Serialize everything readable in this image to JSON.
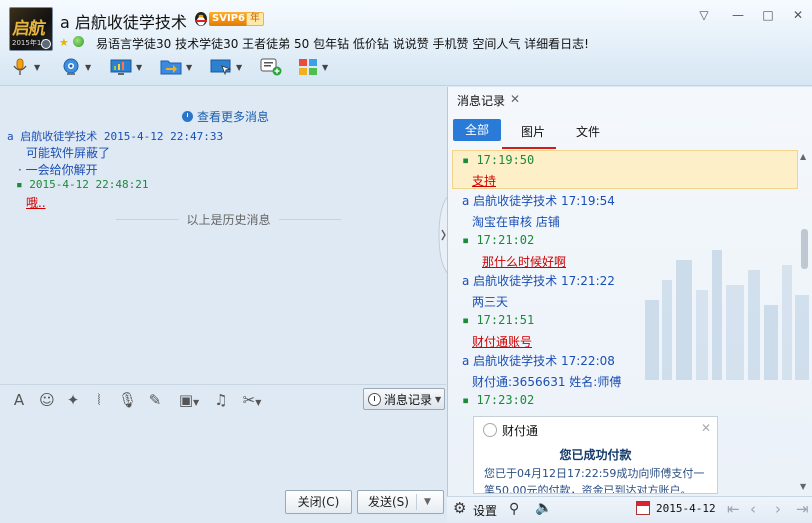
{
  "contact": {
    "name": "a 启航收徒学技术",
    "vip_level": "SVIP6",
    "vip_suffix": "年",
    "avatar_text": "启航",
    "avatar_year": "2015年1月",
    "signature": "易语言学徒30 技术学徒30 王者徒弟 50 包年钻 低价钻  说说赞 手机赞 空间人气 详细看日志!"
  },
  "window_controls": {
    "skin": "▽",
    "minimize": "—",
    "maximize": "□",
    "close": "✕"
  },
  "toolbar": {
    "items": [
      {
        "name": "microphone-icon"
      },
      {
        "name": "webcam-icon"
      },
      {
        "name": "screen-share-icon"
      },
      {
        "name": "file-transfer-icon"
      },
      {
        "name": "remote-desktop-icon"
      },
      {
        "name": "create-discussion-icon"
      },
      {
        "name": "apps-icon"
      }
    ]
  },
  "chat": {
    "more_history": "查看更多消息",
    "messages": [
      {
        "header": "a 启航收徒学技术  2015-4-12 22:47:33",
        "lines": [
          "可能软件屏蔽了",
          "一会给你解开"
        ]
      },
      {
        "header": "2015-4-12 22:48:21",
        "lines": [
          "哦.."
        ]
      }
    ],
    "history_divider": "以上是历史消息"
  },
  "input_toolbar": {
    "message_log_label": "消息记录"
  },
  "buttons": {
    "close": "关闭(C)",
    "send": "发送(S)"
  },
  "panel": {
    "title": "消息记录",
    "close": "✕",
    "tabs": [
      "全部",
      "图片",
      "文件"
    ],
    "entries": [
      {
        "time": "17:19:50",
        "text": "支持"
      },
      {
        "header": "a 启航收徒学技术 17:19:54",
        "text": "淘宝在审核 店铺"
      },
      {
        "time": "17:21:02",
        "text": "那什么时候好啊"
      },
      {
        "header": "a 启航收徒学技术 17:21:22",
        "text": "两三天"
      },
      {
        "time": "17:21:51",
        "text": "财付通账号"
      },
      {
        "header": "a 启航收徒学技术 17:22:08",
        "text": "财付通:3656631 姓名:师傅"
      },
      {
        "time": "17:23:02"
      }
    ],
    "pay_card": {
      "name": "财付通",
      "title": "您已成功付款",
      "line1": "您已于04月12日17:22:59成功向师傅支付一",
      "line2": "笔50.00元的付款，资金已到达对方账户。"
    },
    "bottom": {
      "settings": "设置",
      "date": "2015-4-12"
    }
  }
}
